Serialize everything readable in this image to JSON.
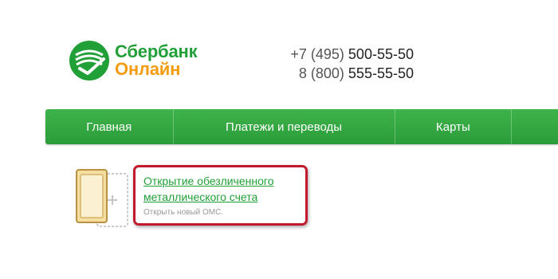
{
  "header": {
    "logo_line1": "Сбербанк",
    "logo_line2": "Онлайн",
    "phone1_prefix": "+7 (495)",
    "phone1_number": "500-55-50",
    "phone2_prefix": "8 (800)",
    "phone2_number": "555-55-50"
  },
  "nav": {
    "items": [
      {
        "label": "Главная"
      },
      {
        "label": "Платежи и переводы"
      },
      {
        "label": "Карты"
      }
    ]
  },
  "content": {
    "oms_link_label": "Открытие обезличенного металлического счета",
    "oms_subtitle": "Открыть новый ОМС."
  },
  "colors": {
    "brand_green": "#21a038",
    "brand_orange": "#f39c12",
    "highlight_red": "#c21a2c"
  }
}
